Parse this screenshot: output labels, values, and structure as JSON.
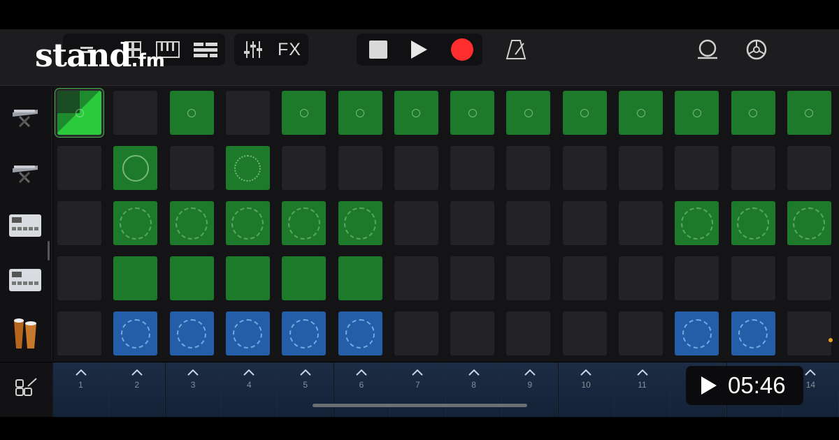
{
  "brand": {
    "name": "stand",
    "suffix": ".fm"
  },
  "toolbar": {
    "fx_label": "FX",
    "icons": [
      "tracks-view-icon",
      "live-loops-grid-icon",
      "keyboard-icon",
      "track-list-icon",
      "mixer-icon",
      "stop-icon",
      "play-icon",
      "record-icon",
      "metronome-icon",
      "loop-browser-icon",
      "settings-icon"
    ],
    "colors": {
      "record": "#ff2d2d",
      "transport_bg": "#111113"
    }
  },
  "tracks": [
    {
      "name": "keyboard-synth",
      "icon": "synth-keyboard-icon",
      "row": [
        0,
        0,
        1,
        0,
        1,
        1,
        1,
        1,
        1,
        1,
        1,
        1,
        1,
        1
      ]
    },
    {
      "name": "keyboard-synth-2",
      "icon": "synth-keyboard-icon",
      "row": [
        0,
        1,
        0,
        1,
        0,
        0,
        0,
        0,
        0,
        0,
        0,
        0,
        0,
        0
      ]
    },
    {
      "name": "drum-machine",
      "icon": "drum-machine-icon",
      "row": [
        0,
        1,
        1,
        1,
        1,
        1,
        0,
        0,
        0,
        0,
        0,
        1,
        1,
        1
      ]
    },
    {
      "name": "drum-machine-2",
      "icon": "drum-machine-icon",
      "row": [
        0,
        1,
        1,
        1,
        1,
        1,
        0,
        0,
        0,
        0,
        0,
        0,
        0,
        0
      ]
    },
    {
      "name": "percussion",
      "icon": "conga-drums-icon",
      "row": [
        0,
        2,
        2,
        2,
        2,
        2,
        0,
        0,
        0,
        0,
        0,
        2,
        2,
        0
      ]
    }
  ],
  "columns": [
    "1",
    "2",
    "3",
    "4",
    "5",
    "6",
    "7",
    "8",
    "9",
    "10",
    "11",
    "12",
    "13",
    "14"
  ],
  "video": {
    "duration": "05:46",
    "icon": "play-icon"
  },
  "colors": {
    "green": "#1d7a2b",
    "blue": "#245ea8",
    "empty": "#232325"
  }
}
